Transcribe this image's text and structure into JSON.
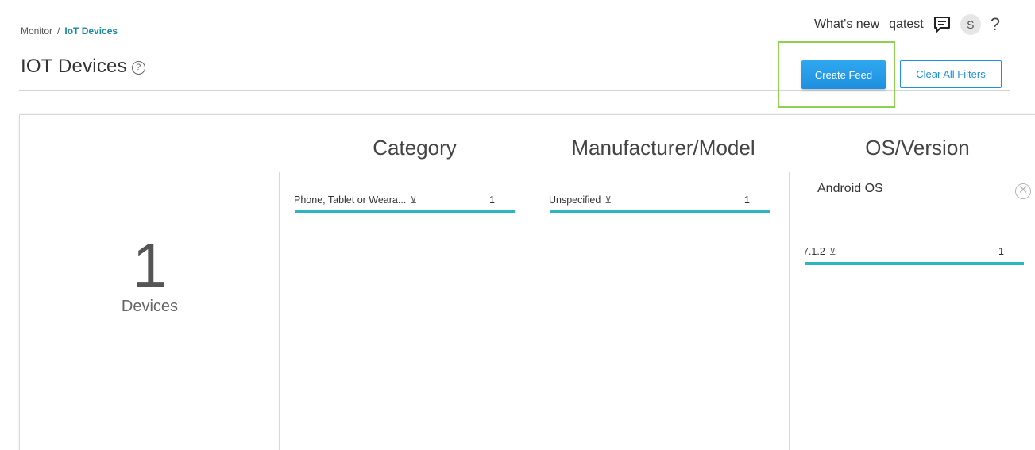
{
  "breadcrumb": {
    "root": "Monitor",
    "separator": "/",
    "current": "IoT Devices"
  },
  "page": {
    "title": "IOT Devices",
    "help_icon": "?"
  },
  "topbar": {
    "whats_new": "What's new",
    "user": "qatest",
    "feedback_icon": "feedback-icon",
    "avatar_initial": "S",
    "help": "?"
  },
  "actions": {
    "create_feed": "Create Feed",
    "clear_filters": "Clear All Filters"
  },
  "summary": {
    "count": "1",
    "label": "Devices"
  },
  "columns": {
    "category": {
      "heading": "Category",
      "items": [
        {
          "label": "Phone, Tablet or Weara...",
          "count": "1",
          "fill": 1.0
        }
      ]
    },
    "manufacturer": {
      "heading": "Manufacturer/Model",
      "items": [
        {
          "label": "Unspecified",
          "count": "1",
          "fill": 1.0
        }
      ]
    },
    "os": {
      "heading": "OS/Version",
      "group": "Android OS",
      "items": [
        {
          "label": "7.1.2",
          "count": "1",
          "fill": 1.0
        }
      ]
    }
  },
  "colors": {
    "bar": "#2bb6c0",
    "primary": "#1e8fe0",
    "highlight": "#8fd14f"
  }
}
